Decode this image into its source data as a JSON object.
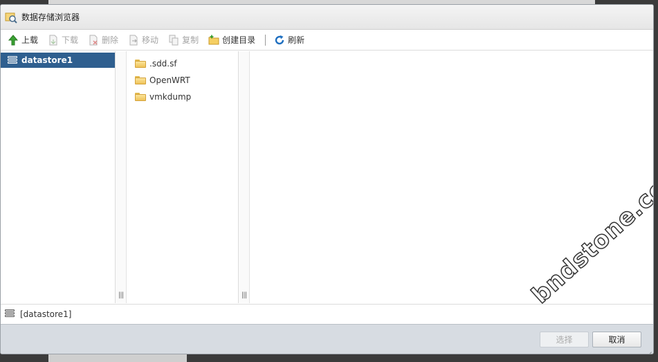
{
  "dialog": {
    "title": "数据存储浏览器",
    "title_icon": "datastore-browser-icon"
  },
  "toolbar": {
    "upload": "上载",
    "download": "下载",
    "delete": "删除",
    "move": "移动",
    "copy": "复制",
    "create_dir": "创建目录",
    "refresh": "刷新"
  },
  "datastores": [
    {
      "name": "datastore1",
      "selected": true
    }
  ],
  "files": [
    {
      "name": ".sdd.sf"
    },
    {
      "name": "OpenWRT"
    },
    {
      "name": "vmkdump"
    }
  ],
  "path": "[datastore1]",
  "buttons": {
    "select": "选择",
    "cancel": "取消"
  },
  "watermark": "bndstone.com",
  "colors": {
    "selection": "#2f5f8f",
    "footer": "#d7dce2"
  }
}
